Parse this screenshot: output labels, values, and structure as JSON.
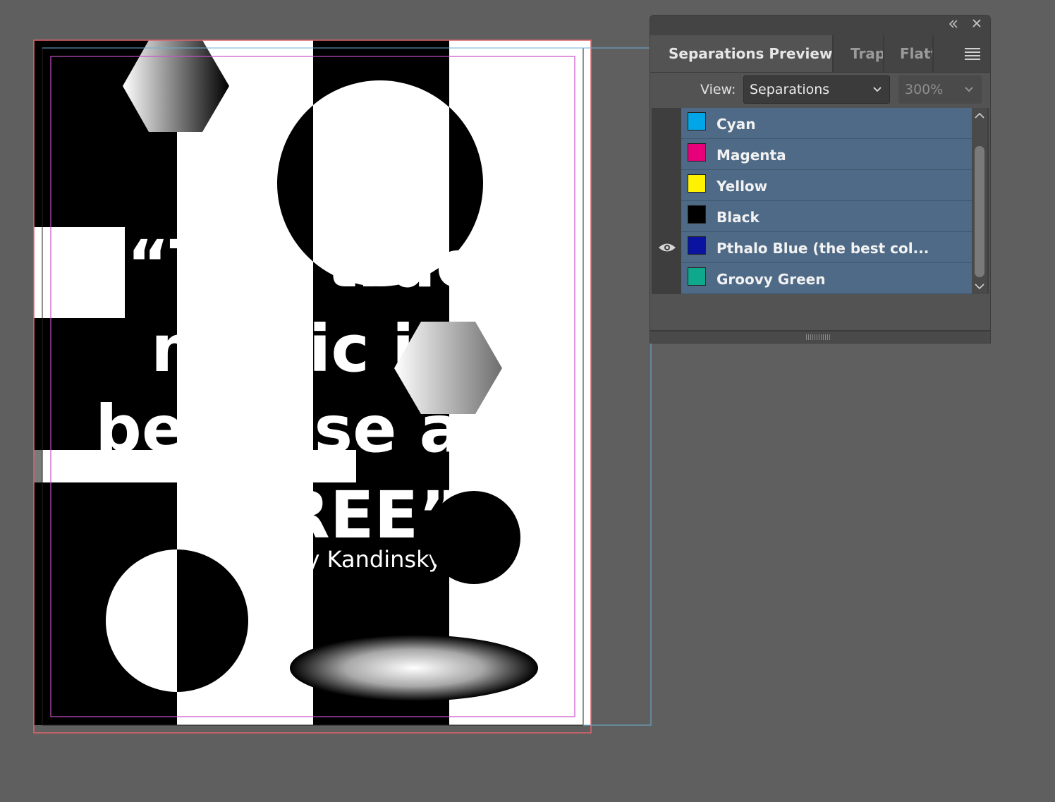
{
  "document": {
    "quote_lines": [
      "“The true",
      "magic in art",
      "because art is",
      "FREE”"
    ],
    "attribution": "— Wassily Kandinsky"
  },
  "panel": {
    "collapse_icon": "double-chevron-left-icon",
    "close_icon": "close-icon",
    "tabs": [
      {
        "label": "Separations Preview",
        "active": true
      },
      {
        "label": "Trap",
        "active": false
      },
      {
        "label": "Flatt",
        "active": false
      }
    ],
    "menu_icon": "panel-menu-icon",
    "view_label": "View:",
    "view_value": "Separations",
    "zoom_value": "300%",
    "separations": [
      {
        "label": "Cyan",
        "color": "#00a6e8",
        "visible": false
      },
      {
        "label": "Magenta",
        "color": "#e8007a",
        "visible": false
      },
      {
        "label": "Yellow",
        "color": "#fff200",
        "visible": false
      },
      {
        "label": "Black",
        "color": "#000000",
        "visible": false
      },
      {
        "label": "Pthalo Blue (the best col...",
        "color": "#0a13a0",
        "visible": true
      },
      {
        "label": "Groovy Green",
        "color": "#0ea88c",
        "visible": false
      }
    ]
  },
  "colors": {
    "bleed_guide": "#e0656a",
    "margin_guide": "#c850c8",
    "column_guide": "#6ab0d6",
    "panel_row": "#4e6a86"
  }
}
